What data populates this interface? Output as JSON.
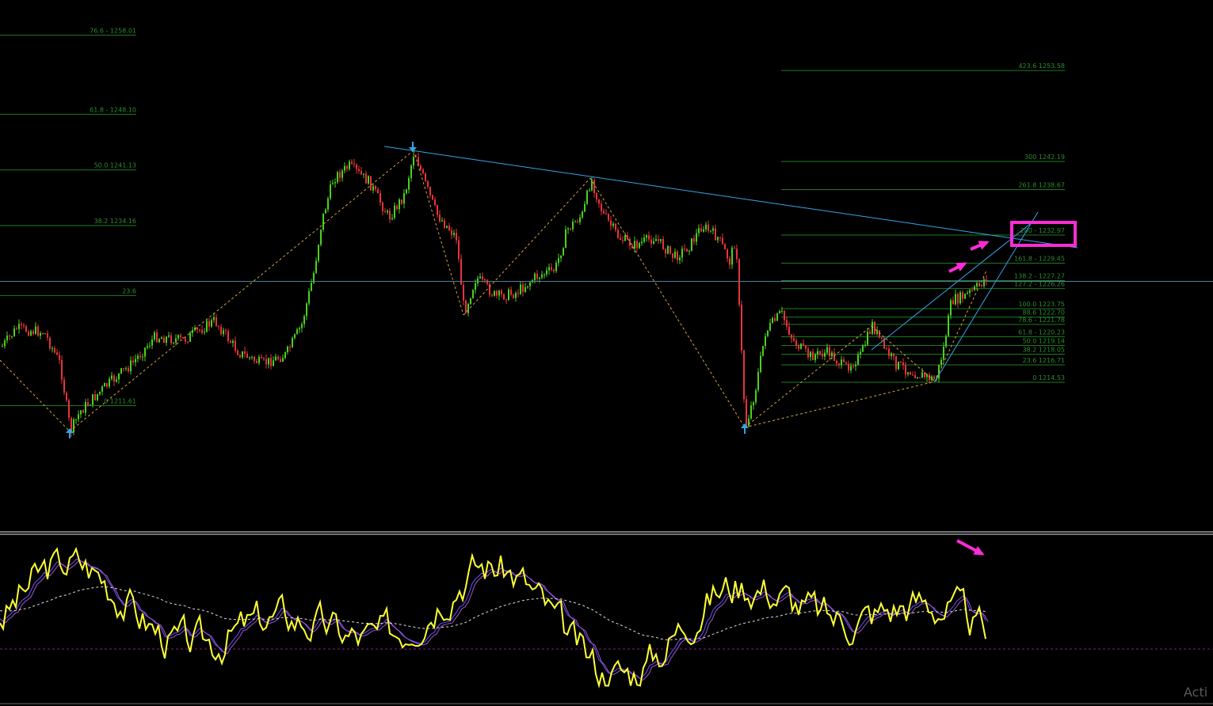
{
  "colors": {
    "background": "#000000",
    "fib_line": "#1f7a1f",
    "fib_text": "#2e8b2e",
    "bull": "#4ad11d",
    "bear": "#e8343a",
    "trend": "#33a6e8",
    "zigzag": "#d9a43a",
    "highlight": "#ff2bd6",
    "stoch_main": "#ffff33",
    "stoch_signal": "#6a52ff",
    "stoch_signal2": "#a255d0",
    "stoch_avg": "#e0e0e0",
    "stoch_level": "#8b1a8b"
  },
  "watermark": "Acti",
  "chart_data": [
    {
      "type": "candlestick",
      "title": "",
      "price_lines": [
        1227.27
      ],
      "fib_left": {
        "levels": [
          {
            "label": "76.6 - 1258.01",
            "price": 1258.01
          },
          {
            "label": "61.8 - 1248.10",
            "price": 1248.1
          },
          {
            "label": "50.0 1241.13",
            "price": 1241.13
          },
          {
            "label": "38.2 1234.16",
            "price": 1234.16
          },
          {
            "label": "23.6",
            "price": 1225.4
          },
          {
            "label": "0 1211.61",
            "price": 1211.61
          }
        ]
      },
      "fib_right": {
        "levels": [
          {
            "label": "423.6 1253.58",
            "price": 1253.58
          },
          {
            "label": "300 1242.19",
            "price": 1242.19
          },
          {
            "label": "261.8 1238.67",
            "price": 1238.67
          },
          {
            "label": "200 - 1232.97",
            "price": 1232.97
          },
          {
            "label": "161.8 - 1229.45",
            "price": 1229.45
          },
          {
            "label": "138.2 - 1227.27",
            "price": 1227.27
          },
          {
            "label": "127.2 - 1226.26",
            "price": 1226.26
          },
          {
            "label": "100.0 1223.75",
            "price": 1223.75
          },
          {
            "label": "88.6 1222.70",
            "price": 1222.7
          },
          {
            "label": "78.6 - 1221.78",
            "price": 1221.78
          },
          {
            "label": "61.8 - 1220.23",
            "price": 1220.23
          },
          {
            "label": "50.0 1219.14",
            "price": 1219.14
          },
          {
            "label": "38.2 1218.05",
            "price": 1218.05
          },
          {
            "label": "23.6 1216.71",
            "price": 1216.71
          },
          {
            "label": "0 1214.53",
            "price": 1214.53
          }
        ]
      },
      "highlighted_level": "200 - 1232.97",
      "swing_points": [
        {
          "kind": "low",
          "price": 1208.6
        },
        {
          "kind": "high",
          "price": 1241.9
        },
        {
          "kind": "low",
          "price": 1208.8
        }
      ]
    },
    {
      "type": "line",
      "title": "",
      "series": [
        {
          "values": []
        },
        {
          "values": []
        },
        {
          "values": []
        }
      ],
      "levels": [
        20
      ]
    }
  ]
}
